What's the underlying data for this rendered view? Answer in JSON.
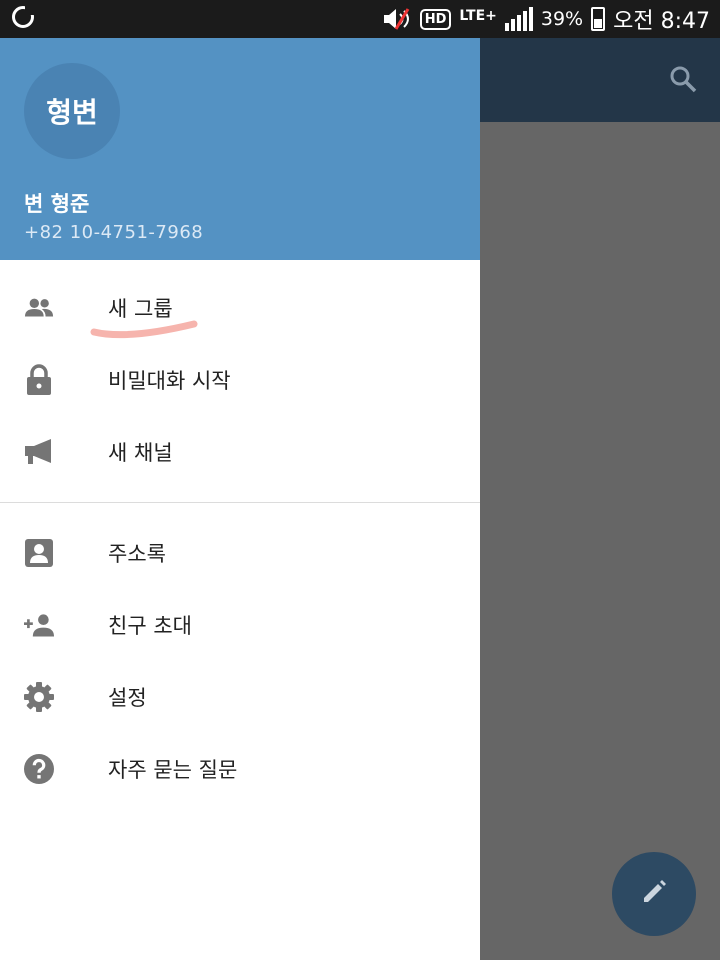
{
  "status_bar": {
    "battery_percent": "39%",
    "clock": "오전 8:47",
    "network": "LTE+",
    "hd_label": "HD"
  },
  "drawer": {
    "avatar_initials": "형변",
    "user_name": "변 형준",
    "phone": "+82 10-4751-7968",
    "header_color": "#5492c3",
    "menu_primary": [
      {
        "label": "새 그룹",
        "icon": "group-icon"
      },
      {
        "label": "비밀대화 시작",
        "icon": "lock-icon"
      },
      {
        "label": "새 채널",
        "icon": "megaphone-icon"
      }
    ],
    "menu_secondary": [
      {
        "label": "주소록",
        "icon": "contacts-icon"
      },
      {
        "label": "친구 초대",
        "icon": "add-person-icon"
      },
      {
        "label": "설정",
        "icon": "gear-icon"
      },
      {
        "label": "자주 묻는 질문",
        "icon": "help-icon"
      }
    ]
  },
  "background_app": {
    "toolbar_color": "#233648",
    "fab_icon": "pencil-icon"
  }
}
